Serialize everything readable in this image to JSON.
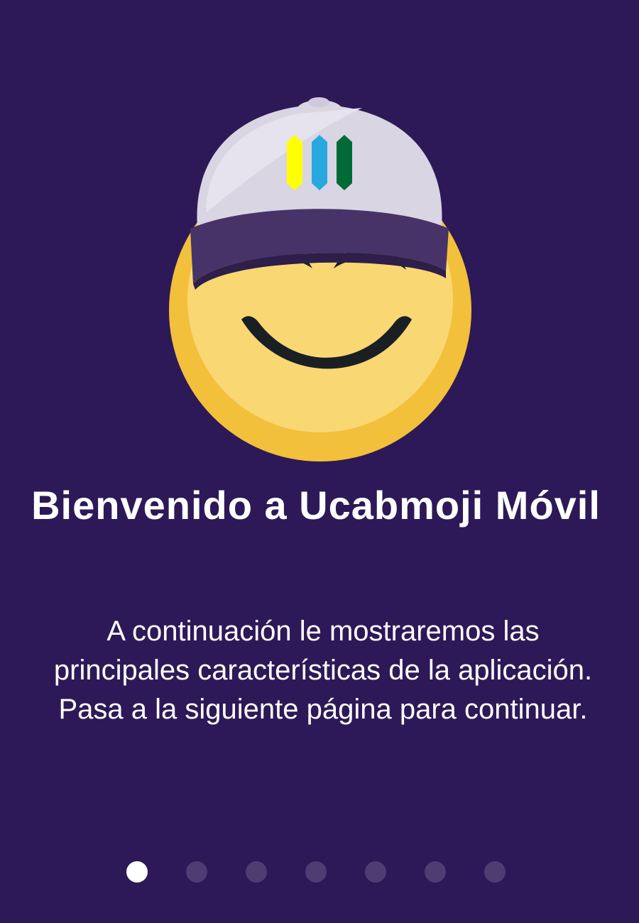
{
  "onboarding": {
    "title": "Bienvenido a Ucabmoji Móvil",
    "description": "A continuación le mostraremos las principales características de la aplicación. Pasa a la siguiente página para continuar.",
    "mascot": {
      "icon": "smiley-cap-mascot-icon",
      "cap_stripe_colors": [
        "#ffff00",
        "#29a8e0",
        "#006b36"
      ]
    },
    "pager": {
      "total_pages": 7,
      "current_page": 1
    }
  },
  "colors": {
    "background": "#2d1957",
    "active_dot": "#ffffff",
    "inactive_dot": "#4e3c73"
  }
}
